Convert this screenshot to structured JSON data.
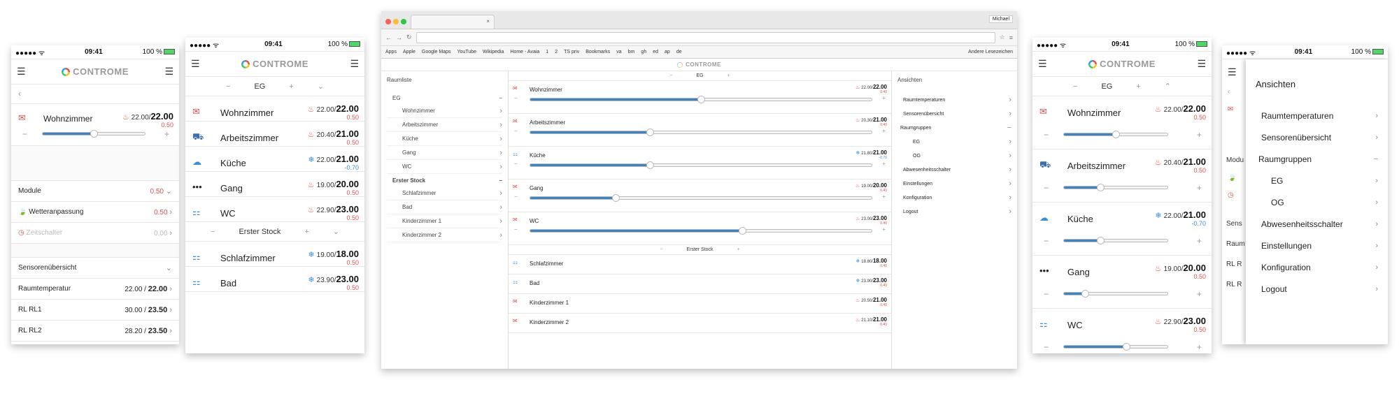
{
  "status": {
    "carrier": "●●●●● ᯤ",
    "time": "09:41",
    "battery": "100 %"
  },
  "brand": {
    "name": "CONTROME"
  },
  "groups": {
    "eg": "EG",
    "og": "Erster Stock"
  },
  "rooms_eg": [
    {
      "name": "Wohnzimmer",
      "actual": "22.00",
      "target": "22.00",
      "offset": "0.50",
      "mode": "heat",
      "icon": "envelope-icon",
      "level": 0.5
    },
    {
      "name": "Arbeitszimmer",
      "actual": "20.40",
      "target": "21.00",
      "offset": "0.50",
      "mode": "heat",
      "icon": "armchair-icon",
      "level": 0.35
    },
    {
      "name": "Küche",
      "actual": "22.00",
      "target": "21.00",
      "offset": "-0.70",
      "mode": "cool",
      "icon": "chef-hat-icon",
      "level": 0.35
    },
    {
      "name": "Gang",
      "actual": "19.00",
      "target": "20.00",
      "offset": "0.50",
      "mode": "heat",
      "icon": "dots-icon",
      "level": 0.2
    },
    {
      "name": "WC",
      "actual": "22.90",
      "target": "23.00",
      "offset": "0.50",
      "mode": "heat",
      "icon": "shower-icon",
      "level": 0.6
    }
  ],
  "rooms_og": [
    {
      "name": "Schlafzimmer",
      "actual": "19.00",
      "target": "18.00",
      "offset": "0.50",
      "mode": "cool"
    },
    {
      "name": "Bad",
      "actual": "23.90",
      "target": "23.00",
      "offset": "0.50",
      "mode": "cool"
    }
  ],
  "browser_rooms_og": [
    {
      "name": "Schlafzimmer",
      "actual": "18.80",
      "target": "18.00",
      "offset": "0.40",
      "mode": "cool"
    },
    {
      "name": "Bad",
      "actual": "23.90",
      "target": "23.00",
      "offset": "0.40",
      "mode": "cool"
    },
    {
      "name": "Kinderzimmer 1",
      "actual": "20.50",
      "target": "21.00",
      "offset": "0.40",
      "mode": "heat"
    },
    {
      "name": "Kinderzimmer 2",
      "actual": "21.10",
      "target": "21.00",
      "offset": "0.40",
      "mode": "heat"
    }
  ],
  "browser_rooms_eg": [
    {
      "name": "Wohnzimmer",
      "actual": "22.00",
      "target": "22.00",
      "offset": "0.40",
      "mode": "heat",
      "level": 0.5
    },
    {
      "name": "Arbeitszimmer",
      "actual": "20.30",
      "target": "21.00",
      "offset": "0.40",
      "mode": "heat",
      "level": 0.35
    },
    {
      "name": "Küche",
      "actual": "21.80",
      "target": "21.00",
      "offset": "-0.70",
      "mode": "cool",
      "level": 0.35
    },
    {
      "name": "Gang",
      "actual": "19.00",
      "target": "20.00",
      "offset": "0.40",
      "mode": "heat",
      "level": 0.25
    },
    {
      "name": "WC",
      "actual": "23.00",
      "target": "23.00",
      "offset": "0.40",
      "mode": "heat",
      "level": 0.62
    }
  ],
  "phone1": {
    "room": {
      "name": "Wohnzimmer",
      "actual": "22.00",
      "target": "22.00",
      "offset": "0.50",
      "level": 0.5
    },
    "modules_label": "Module",
    "modules_value": "0.50",
    "wetter_label": "Wetteranpassung",
    "wetter_value": "0.50",
    "zeit_label": "Zeitschalter",
    "zeit_value": "0.00",
    "sensor_label": "Sensorenübersicht",
    "sensors": [
      {
        "name": "Raumtemperatur",
        "a": "22.00",
        "b": "22.00"
      },
      {
        "name": "RL RL1",
        "a": "30.00",
        "b": "23.50"
      },
      {
        "name": "RL RL2",
        "a": "28.20",
        "b": "23.50"
      }
    ]
  },
  "browser": {
    "tab_title": "",
    "user": "Michael",
    "bookmarks": [
      "Apps",
      "Apple",
      "Google Maps",
      "YouTube",
      "Wikipedia",
      "Home - Avaia",
      "1",
      "2",
      "TS priv",
      "Bookmarks",
      "va",
      "bm",
      "gh",
      "ed",
      "ap",
      "de"
    ],
    "other_bookmarks": "Andere Lesezeichen",
    "sidebar_title": "Raumliste",
    "sidebar_eg": [
      "Wohnzimmer",
      "Arbeitszimmer",
      "Küche",
      "Gang",
      "WC"
    ],
    "sidebar_og": [
      "Schlafzimmer",
      "Bad",
      "Kinderzimmer 1",
      "Kinderzimmer 2"
    ],
    "right_title": "Ansichten"
  },
  "menu": {
    "title": "Ansichten",
    "items": [
      "Raumtemperaturen",
      "Sensorenübersicht"
    ],
    "raumgruppen": "Raumgruppen",
    "groups": [
      "EG",
      "OG"
    ],
    "items2": [
      "Abwesenheitsschalter",
      "Einstellungen",
      "Konfiguration",
      "Logout"
    ]
  },
  "drawer_peek": {
    "modu": "Modu",
    "sens": "Sens",
    "raum": "Raum",
    "rl1": "RL R",
    "rl2": "RL R"
  },
  "colors": {
    "accent": "#3a84c6",
    "heat": "#e05050",
    "cool": "#3a8fd8"
  }
}
